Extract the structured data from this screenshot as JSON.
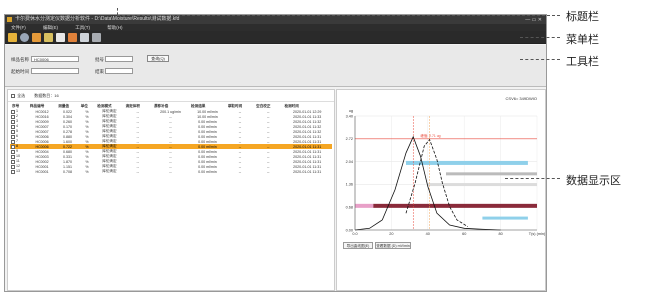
{
  "app": {
    "title": "卡尔费休水分测定仪数据分析软件 - D:\\Data\\Moisture\\Results\\测试数据.kfd",
    "window_controls": "— ▭ ✕"
  },
  "menu": [
    "文件(F)",
    "编辑(E)",
    "工具(T)",
    "帮助(H)"
  ],
  "toolbar_icons": [
    "open-folder-icon",
    "settings-icon",
    "report-icon",
    "print-icon",
    "export-icon",
    "save-icon",
    "delete-icon",
    "exit-icon"
  ],
  "filter": {
    "label1": "样品名称",
    "value1": "HC0006",
    "label2": "起始时间",
    "value2": "",
    "label3": "批号",
    "value3": "",
    "label4": "结束",
    "value4": "",
    "query_button": "查询(Q)"
  },
  "list": {
    "select_all_label": "全选",
    "count_label": "数据数目：16",
    "columns": [
      "序号",
      "样品编号",
      "测量值",
      "单位",
      "检测模式",
      "滴定体积",
      "漂移补偿",
      "检测结果",
      "萃取时间",
      "空白校正",
      "检测时间"
    ],
    "rows": [
      [
        "1",
        "HC0012",
        "0.022",
        "%",
        "库伦滴定",
        "--",
        "200.1 ug/min",
        "10.00 ml/min",
        "--",
        "--",
        "2020-01-01 12:29"
      ],
      [
        "2",
        "HC0016",
        "0.304",
        "%",
        "库伦滴定",
        "--",
        "--",
        "10.00 ml/min",
        "--",
        "--",
        "2020-01-01 11:33"
      ],
      [
        "3",
        "HC0009",
        "0.260",
        "%",
        "库伦滴定",
        "--",
        "--",
        "0.00 ml/min",
        "--",
        "--",
        "2020-01-01 11:32"
      ],
      [
        "4",
        "HC0007",
        "0.170",
        "%",
        "库伦滴定",
        "--",
        "--",
        "0.00 ml/min",
        "--",
        "--",
        "2020-01-01 11:32"
      ],
      [
        "5",
        "HC0007",
        "0.278",
        "%",
        "库伦滴定",
        "--",
        "--",
        "0.00 ml/min",
        "--",
        "--",
        "2020-01-01 11:32"
      ],
      [
        "6",
        "HC0006",
        "0.880",
        "%",
        "库伦滴定",
        "--",
        "--",
        "0.00 ml/min",
        "--",
        "--",
        "2020-01-01 11:31"
      ],
      [
        "7",
        "HC0006",
        "1.600",
        "%",
        "库伦滴定",
        "--",
        "--",
        "0.00 ml/min",
        "--",
        "--",
        "2020-01-01 11:31"
      ],
      [
        "8",
        "HC0006",
        "0.722",
        "%",
        "库伦滴定",
        "--",
        "--",
        "0.00 ml/min",
        "--",
        "--",
        "2020-01-01 11:31"
      ],
      [
        "9",
        "HC0004",
        "0.680",
        "%",
        "库伦滴定",
        "--",
        "--",
        "0.00 ml/min",
        "--",
        "--",
        "2020-01-01 11:31"
      ],
      [
        "10",
        "HC0003",
        "0.331",
        "%",
        "库伦滴定",
        "--",
        "--",
        "0.00 ml/min",
        "--",
        "--",
        "2020-01-01 11:31"
      ],
      [
        "11",
        "HC0002",
        "1.870",
        "%",
        "库伦滴定",
        "--",
        "--",
        "0.00 ml/min",
        "--",
        "--",
        "2020-01-01 11:31"
      ],
      [
        "12",
        "HC0001",
        "1.151",
        "%",
        "库伦滴定",
        "--",
        "--",
        "0.00 ml/min",
        "--",
        "--",
        "2020-01-01 11:31"
      ],
      [
        "13",
        "HC0001",
        "0.708",
        "%",
        "库伦滴定",
        "--",
        "--",
        "0.00 ml/min",
        "--",
        "--",
        "2020-01-01 11:31"
      ]
    ],
    "selected_row": 7
  },
  "chart_data": {
    "type": "line",
    "title": "",
    "corner_label": "CSV6= 349DWIO",
    "ylabel": "ug",
    "xlabel": "T(s) (min)",
    "x_ticks": [
      "0.0",
      "20",
      "40",
      "60",
      "80",
      "T(s) (min)"
    ],
    "y_ticks": [
      "3.40",
      "2.72",
      "2.04",
      "1.36",
      "0.68",
      "0.00"
    ],
    "xlim": [
      0,
      100
    ],
    "ylim": [
      0,
      3.4
    ],
    "marker_label": "峰值: 2.71 ug",
    "series": [
      {
        "values": [
          [
            0,
            0
          ],
          [
            8,
            0.05
          ],
          [
            15,
            0.3
          ],
          [
            22,
            1.2
          ],
          [
            28,
            2.3
          ],
          [
            32,
            2.78
          ],
          [
            36,
            2.2
          ],
          [
            40,
            1.3
          ],
          [
            45,
            0.5
          ],
          [
            52,
            0.15
          ],
          [
            60,
            0.05
          ],
          [
            70,
            0.02
          ],
          [
            80,
            0
          ]
        ]
      },
      {
        "values": [
          [
            28,
            0.5
          ],
          [
            33,
            1.4
          ],
          [
            38,
            2.5
          ],
          [
            41,
            2.7
          ],
          [
            45,
            2.1
          ],
          [
            48,
            1.4
          ],
          [
            52,
            0.7
          ],
          [
            56,
            0.3
          ],
          [
            62,
            0.1
          ]
        ]
      }
    ],
    "colors": {
      "bars_blue": "#8fd0ea",
      "bars_dark": "#8a2a3a",
      "bars_gray": "#bbbbbb",
      "red_line": "#e84a3c",
      "orange_line": "#f0a45a"
    }
  },
  "chart_buttons": [
    "导出曲线图(E)",
    "查看数据 (D) mV/min"
  ],
  "annotations": [
    "标题栏",
    "菜单栏",
    "工具栏",
    "数据显示区"
  ]
}
